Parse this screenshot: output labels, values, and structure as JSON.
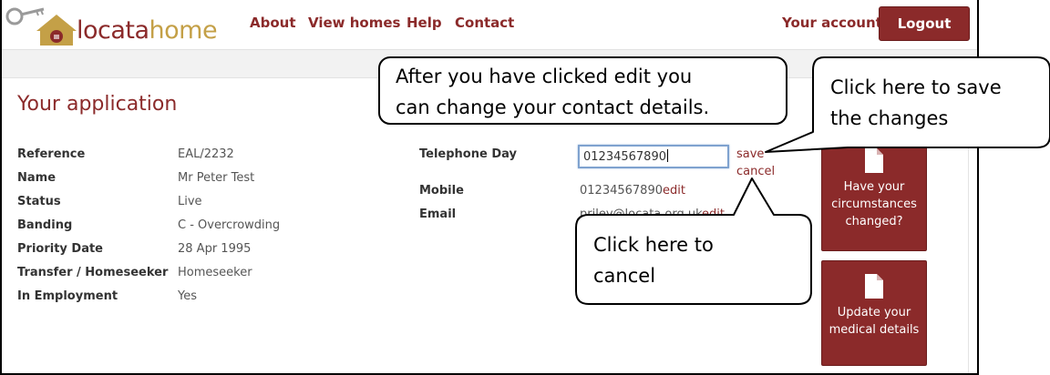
{
  "header": {
    "logo_part1": "locata",
    "logo_part2": "home",
    "nav": {
      "about": "About",
      "view_homes": "View homes",
      "help": "Help",
      "contact": "Contact"
    },
    "your_account": "Your account",
    "logout": "Logout"
  },
  "page": {
    "title": "Your application"
  },
  "details": [
    {
      "label": "Reference",
      "value": "EAL/2232"
    },
    {
      "label": "Name",
      "value": "Mr Peter Test"
    },
    {
      "label": "Status",
      "value": "Live"
    },
    {
      "label": "Banding",
      "value": "C - Overcrowding"
    },
    {
      "label": "Priority Date",
      "value": "28 Apr 1995"
    },
    {
      "label": "Transfer / Homeseeker",
      "value": "Homeseeker"
    },
    {
      "label": "In Employment",
      "value": "Yes"
    }
  ],
  "contact": {
    "telephone_day_label": "Telephone Day",
    "telephone_day_value": "01234567890",
    "save": "save",
    "cancel": "cancel",
    "mobile_label": "Mobile",
    "mobile_value": "01234567890",
    "edit": "edit",
    "email_label": "Email",
    "email_value": "priley@locata.org.uk",
    "email_edit": "edit"
  },
  "side_buttons": {
    "circumstances": "Have your circumstances changed?",
    "medical": "Update your medical details"
  },
  "callouts": {
    "edit_line1": "After you have clicked edit you",
    "edit_line2": "can change your contact details.",
    "save_line1": "Click here to save",
    "save_line2": "the changes",
    "cancel_line1": "Click here to",
    "cancel_line2": "cancel"
  },
  "colors": {
    "brand": "#8b2a2a",
    "brand_gold": "#c4a047",
    "input_focus": "#7fa2cf"
  }
}
